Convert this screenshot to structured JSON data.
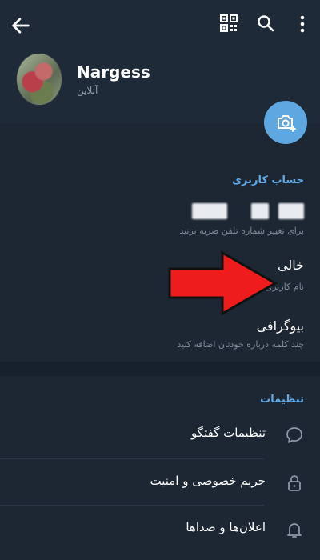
{
  "header": {
    "back_icon": "arrow-left-icon",
    "qr_icon": "qr-code-icon",
    "search_icon": "search-icon",
    "more_icon": "more-vertical-icon"
  },
  "profile": {
    "name": "Nargess",
    "status": "آنلاین",
    "set_photo_icon": "camera-add-icon"
  },
  "account": {
    "title": "حساب کاربری",
    "phone_hint": "برای تغییر شماره تلفن ضربه بزنید",
    "username_value": "خالی",
    "username_hint": "نام کاربری",
    "bio_value": "بیوگرافی",
    "bio_hint": "چند کلمه درباره خودتان اضافه کنید"
  },
  "settings": {
    "title": "تنظیمات",
    "items": [
      {
        "label": "تنظیمات گفتگو",
        "icon": "chat-bubble-icon"
      },
      {
        "label": "حریم خصوصی و امنیت",
        "icon": "lock-icon"
      },
      {
        "label": "اعلان‌ها و صداها",
        "icon": "bell-icon"
      }
    ]
  },
  "colors": {
    "background": "#1d2733",
    "header": "#1e2a38",
    "accent": "#62a9e6",
    "fab": "#5fa7e0",
    "annotation_arrow": "#ee1c1c"
  }
}
